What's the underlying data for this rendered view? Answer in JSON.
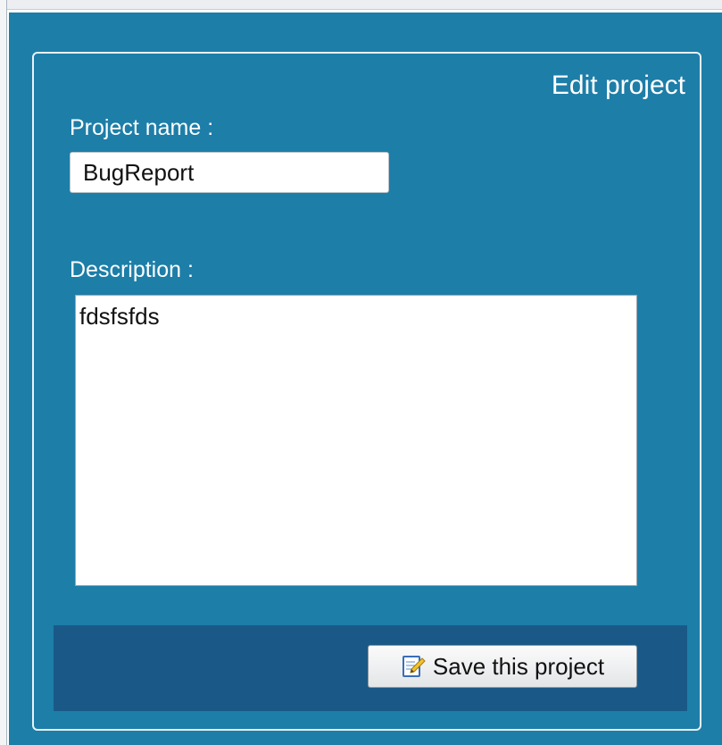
{
  "form": {
    "title": "Edit project",
    "name_label": "Project name :",
    "name_value": "BugReport",
    "description_label": "Description :",
    "description_value": "fdsfsfds"
  },
  "footer": {
    "save_label": "Save this project",
    "save_icon": "edit-document-icon"
  },
  "colors": {
    "panel_background": "#1d7ea8",
    "footer_background": "#1a5987",
    "text_light": "#ffffff"
  }
}
